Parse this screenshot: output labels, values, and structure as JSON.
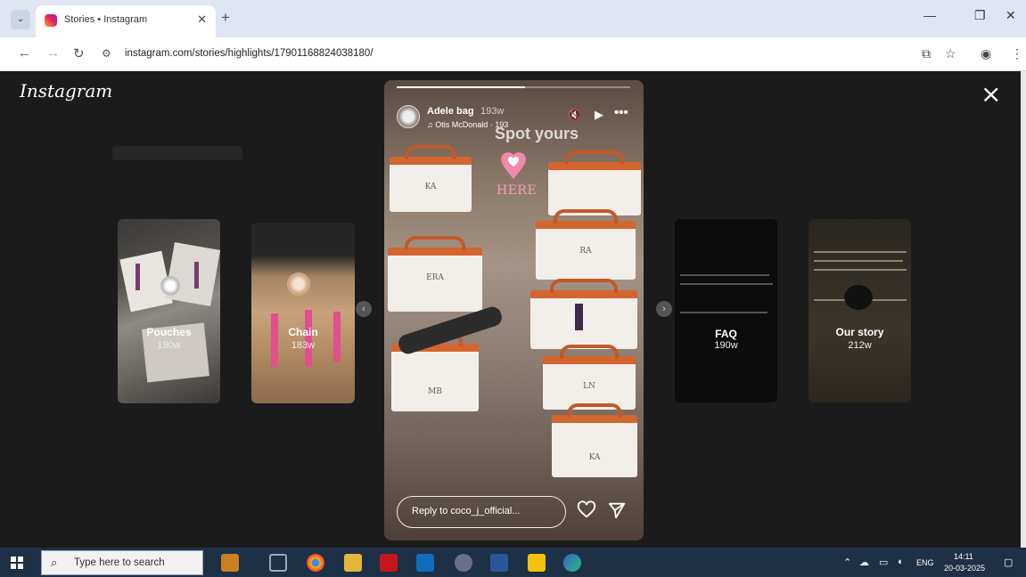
{
  "browser": {
    "tab_title": "Stories • Instagram",
    "url": "instagram.com/stories/highlights/17901168824038180/",
    "icons": [
      "tab-search-icon",
      "close-icon",
      "plus-icon",
      "minimize-icon",
      "restore-icon",
      "back-icon",
      "forward-icon",
      "reload-icon",
      "site-settings-icon",
      "cast-icon",
      "star-icon",
      "profile-icon",
      "menu-icon"
    ]
  },
  "instagram": {
    "logo": "Instagram",
    "close_icon": "×"
  },
  "highlights": [
    {
      "label": "Pouches",
      "time": "190w"
    },
    {
      "label": "Chain",
      "time": "183w"
    },
    {
      "label": "FAQ",
      "time": "190w"
    },
    {
      "label": "Our story",
      "time": "212w"
    }
  ],
  "card_text": {
    "faq_note": "- Lavender bag\n  ... comes in a mini size, too for 150w",
    "story_note": "PS ... to make this bag"
  },
  "story": {
    "username": "Adele bag",
    "time": "193w",
    "music": "♫ Otis McDonald · 193",
    "overlay": "Spot yours",
    "sticker_text": "HERE",
    "bag_monograms": [
      "KA",
      "RA",
      "ERA",
      "KA",
      "MB",
      "LN",
      "KA"
    ],
    "reply_placeholder": "Reply to coco_j_official...",
    "progress_fraction": 0.55
  },
  "taskbar": {
    "search_placeholder": "Type here to search",
    "language": "ENG",
    "time": "14:11",
    "date": "20-03-2025"
  },
  "colors": {
    "accent_pink": "#e24f8e",
    "taskbar": "#1e3046",
    "viewer_bg": "#1b1b1b"
  }
}
